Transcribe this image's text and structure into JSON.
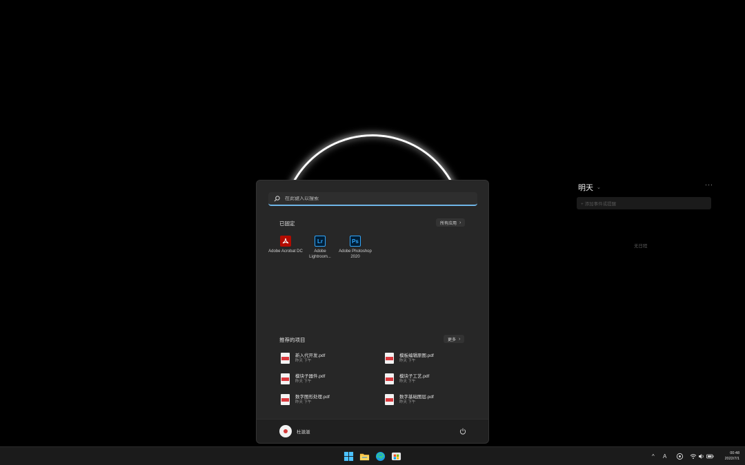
{
  "start_menu": {
    "search_placeholder": "在此键入以搜索",
    "pinned": {
      "title": "已固定",
      "all_apps_label": "所有应用",
      "apps": [
        {
          "label": "Adobe Acrobat DC",
          "icon": "acrobat-icon",
          "color": "#b30b00"
        },
        {
          "label": "Adobe Lightroom...",
          "icon": "lightroom-icon",
          "color": "#31a8ff"
        },
        {
          "label": "Adobe Photoshop 2020",
          "icon": "photoshop-icon",
          "color": "#31a8ff"
        }
      ]
    },
    "recommended": {
      "title": "推荐的项目",
      "more_label": "更多",
      "items": [
        {
          "name": "新入代开发.pdf",
          "time": "昨天 下午"
        },
        {
          "name": "模板编辑原图.pdf",
          "time": "昨天 下午"
        },
        {
          "name": "模块子器件.pdf",
          "time": "昨天 下午"
        },
        {
          "name": "模块子工艺.pdf",
          "time": "昨天 下午"
        },
        {
          "name": "数字图形处理.pdf",
          "time": "昨天 下午"
        },
        {
          "name": "数字基础图层.pdf",
          "time": "昨天 下午"
        }
      ]
    },
    "footer": {
      "user_name": "杜滋滋"
    }
  },
  "widget": {
    "title": "明天",
    "more": "···",
    "input_placeholder": "+ 添加事件或提醒",
    "empty_text": "无日程"
  },
  "taskbar": {
    "tray_chevron": "^",
    "input_indicator": "A",
    "clock_time": "00:48",
    "clock_date": "2022/7/1"
  },
  "colors": {
    "accent": "#6fb6e8",
    "menu_bg": "#272727",
    "taskbar_bg": "#1b1b1b"
  }
}
